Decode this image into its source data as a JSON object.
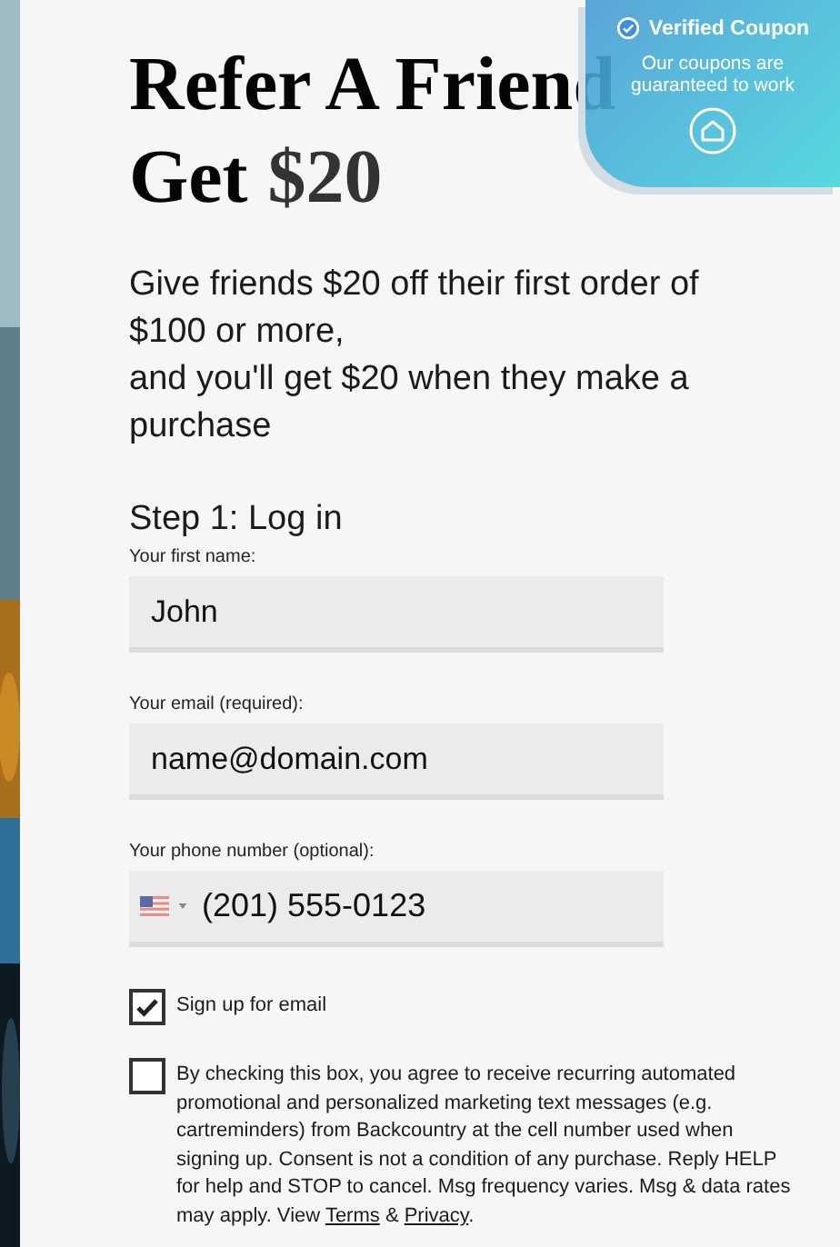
{
  "coupon_badge": {
    "title": "Verified Coupon",
    "text": "Our coupons are guaranteed to work"
  },
  "heading": {
    "line1": "Refer A Friend",
    "line2": "Get",
    "amount": "$20"
  },
  "intro": [
    "Give friends $20 off their first order of $100 or more,",
    "and you'll get $20 when they make a purchase"
  ],
  "step_title": "Step 1: Log in",
  "fields": [
    {
      "kind": "text",
      "label": "Your first name:",
      "value": "John"
    },
    {
      "kind": "text",
      "label": "Your email (required):",
      "value": "name@domain.com"
    },
    {
      "kind": "phone",
      "label": "Your phone number (optional):",
      "value": "(201) 555-0123"
    }
  ],
  "checkboxes": [
    {
      "checked": true,
      "text": "Sign up for email"
    },
    {
      "checked": false,
      "text": "By checking this box, you agree to receive recurring automated promotional and personalized marketing text messages (e.g. cartreminders) from Backcountry at the cell number used when signing up. Consent is not a condition of any purchase. Reply HELP for help and STOP to cancel. Msg frequency varies. Msg & data rates may apply. View",
      "links": [
        "Terms",
        "Privacy"
      ],
      "link_joiner": "&",
      "ending": "."
    }
  ]
}
